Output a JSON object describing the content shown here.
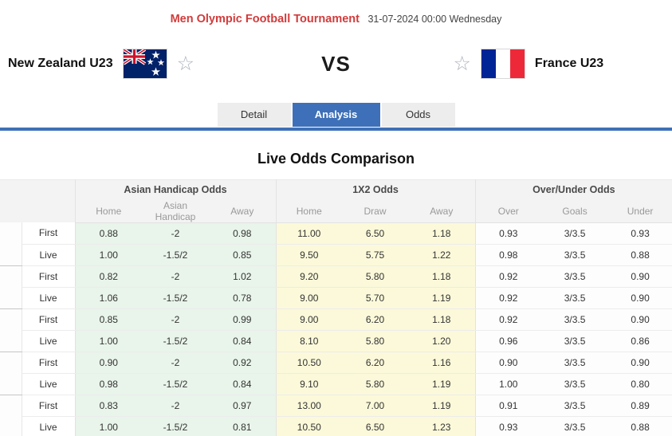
{
  "header": {
    "tournament": "Men Olympic Football Tournament",
    "datetime": "31-07-2024 00:00 Wednesday"
  },
  "match": {
    "home_team": "New Zealand U23",
    "away_team": "France U23",
    "vs_label": "VS",
    "home_flag": "new-zealand-flag",
    "away_flag": "france-flag",
    "favorite_star_icon": "star-outline"
  },
  "tabs": [
    {
      "label": "Detail",
      "active": false
    },
    {
      "label": "Analysis",
      "active": true
    },
    {
      "label": "Odds",
      "active": false
    }
  ],
  "section_title": "Live Odds Comparison",
  "odds_table": {
    "groups": [
      {
        "label": "Asian Handicap Odds",
        "columns": [
          "Home",
          "Asian Handicap",
          "Away"
        ]
      },
      {
        "label": "1X2 Odds",
        "columns": [
          "Home",
          "Draw",
          "Away"
        ]
      },
      {
        "label": "Over/Under Odds",
        "columns": [
          "Over",
          "Goals",
          "Under"
        ]
      }
    ],
    "rows": [
      {
        "type": "First",
        "ah": [
          "0.88",
          "-2",
          "0.98"
        ],
        "x12": [
          "11.00",
          "6.50",
          "1.18"
        ],
        "ou": [
          "0.93",
          "3/3.5",
          "0.93"
        ]
      },
      {
        "type": "Live",
        "ah": [
          "1.00",
          "-1.5/2",
          "0.85"
        ],
        "x12": [
          "9.50",
          "5.75",
          "1.22"
        ],
        "ou": [
          "0.98",
          "3/3.5",
          "0.88"
        ]
      },
      {
        "type": "First",
        "ah": [
          "0.82",
          "-2",
          "1.02"
        ],
        "x12": [
          "9.20",
          "5.80",
          "1.18"
        ],
        "ou": [
          "0.92",
          "3/3.5",
          "0.90"
        ]
      },
      {
        "type": "Live",
        "ah": [
          "1.06",
          "-1.5/2",
          "0.78"
        ],
        "x12": [
          "9.00",
          "5.70",
          "1.19"
        ],
        "ou": [
          "0.92",
          "3/3.5",
          "0.90"
        ]
      },
      {
        "type": "First",
        "ah": [
          "0.85",
          "-2",
          "0.99"
        ],
        "x12": [
          "9.00",
          "6.20",
          "1.18"
        ],
        "ou": [
          "0.92",
          "3/3.5",
          "0.90"
        ]
      },
      {
        "type": "Live",
        "ah": [
          "1.00",
          "-1.5/2",
          "0.84"
        ],
        "x12": [
          "8.10",
          "5.80",
          "1.20"
        ],
        "ou": [
          "0.96",
          "3/3.5",
          "0.86"
        ]
      },
      {
        "type": "First",
        "ah": [
          "0.90",
          "-2",
          "0.92"
        ],
        "x12": [
          "10.50",
          "6.20",
          "1.16"
        ],
        "ou": [
          "0.90",
          "3/3.5",
          "0.90"
        ]
      },
      {
        "type": "Live",
        "ah": [
          "0.98",
          "-1.5/2",
          "0.84"
        ],
        "x12": [
          "9.10",
          "5.80",
          "1.19"
        ],
        "ou": [
          "1.00",
          "3/3.5",
          "0.80"
        ]
      },
      {
        "type": "First",
        "ah": [
          "0.83",
          "-2",
          "0.97"
        ],
        "x12": [
          "13.00",
          "7.00",
          "1.19"
        ],
        "ou": [
          "0.91",
          "3/3.5",
          "0.89"
        ]
      },
      {
        "type": "Live",
        "ah": [
          "1.00",
          "-1.5/2",
          "0.81"
        ],
        "x12": [
          "10.50",
          "6.50",
          "1.23"
        ],
        "ou": [
          "0.93",
          "3/3.5",
          "0.88"
        ]
      }
    ]
  },
  "colors": {
    "accent_red": "#d23b3b",
    "tab_blue": "#3d70b8",
    "ah_green_bg": "#e9f4ea",
    "x12_yellow_bg": "#fbf9d9",
    "ou_bg": "#fdfdfd",
    "header_bg": "#f3f3f3",
    "nz_flag_blue": "#012169",
    "nz_flag_red": "#cc142b",
    "fr_flag_blue": "#002395",
    "fr_flag_red": "#ed2939"
  }
}
